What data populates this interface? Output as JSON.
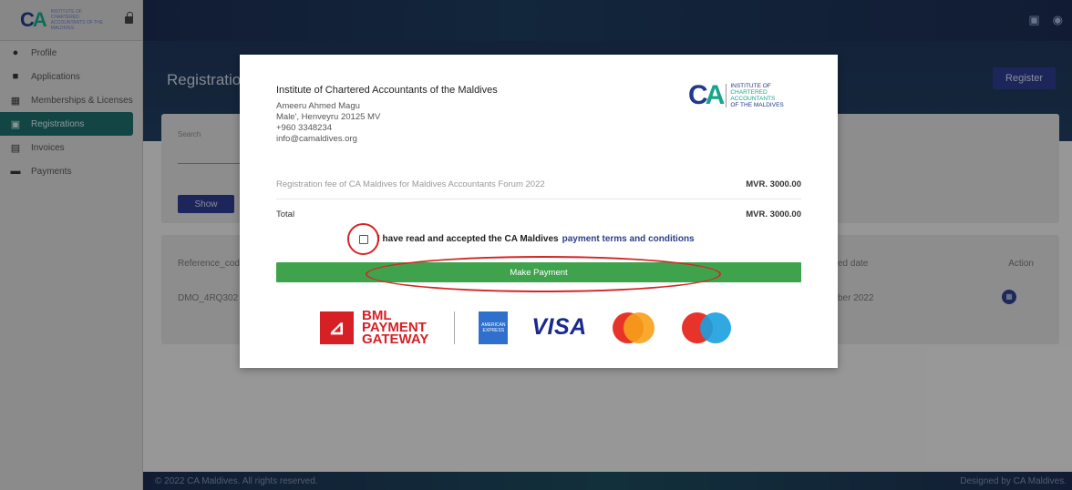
{
  "sidebar": {
    "logo_mark": "CA",
    "logo_text": "Institute of Chartered Accountants of the Maldives",
    "items": [
      {
        "label": "Profile",
        "icon": "user-icon",
        "active": false
      },
      {
        "label": "Applications",
        "icon": "briefcase-icon",
        "active": false
      },
      {
        "label": "Memberships & Licenses",
        "icon": "id-card-icon",
        "active": false
      },
      {
        "label": "Registrations",
        "icon": "calendar-icon",
        "active": true
      },
      {
        "label": "Invoices",
        "icon": "document-icon",
        "active": false
      },
      {
        "label": "Payments",
        "icon": "credit-card-icon",
        "active": false
      }
    ]
  },
  "page": {
    "title": "Registratio",
    "register_button": "Register",
    "search_label": "Search",
    "show_button": "Show",
    "table": {
      "col_reference": "Reference_cod",
      "col_date": "ed date",
      "col_action": "Action",
      "row_reference": "DMO_4RQ302",
      "row_date": "ber 2022"
    }
  },
  "footer": {
    "copyright": "© 2022 CA Maldives. All rights reserved.",
    "designed_by": "Designed by CA Maldives."
  },
  "modal": {
    "org_name": "Institute of Chartered Accountants of the Maldives",
    "address_line1": "Ameeru Ahmed Magu",
    "address_line2": "Male', Henveyru 20125 MV",
    "phone": "+960 3348234",
    "email": "info@camaldives.org",
    "logo_lines": [
      "INSTITUTE OF",
      "CHARTERED",
      "ACCOUNTANTS",
      "OF THE MALDIVES"
    ],
    "fee_description": "Registration fee of CA Maldives for Maldives Accountants Forum 2022",
    "fee_amount": "MVR. 3000.00",
    "total_label": "Total",
    "total_amount": "MVR. 3000.00",
    "terms_text": "I have read and accepted the CA Maldives",
    "terms_link": "payment terms and conditions",
    "terms_checked": false,
    "pay_button": "Make Payment",
    "brands": {
      "bml_line1": "BML",
      "bml_line2": "PAYMENT",
      "bml_line3": "GATEWAY",
      "amex": "AMERICAN EXPRESS",
      "visa": "VISA"
    }
  },
  "colors": {
    "accent": "#2b3b8a",
    "sidebar_active": "#1f6b6a",
    "pay_button": "#3fa34d",
    "annotation": "#d42626"
  }
}
